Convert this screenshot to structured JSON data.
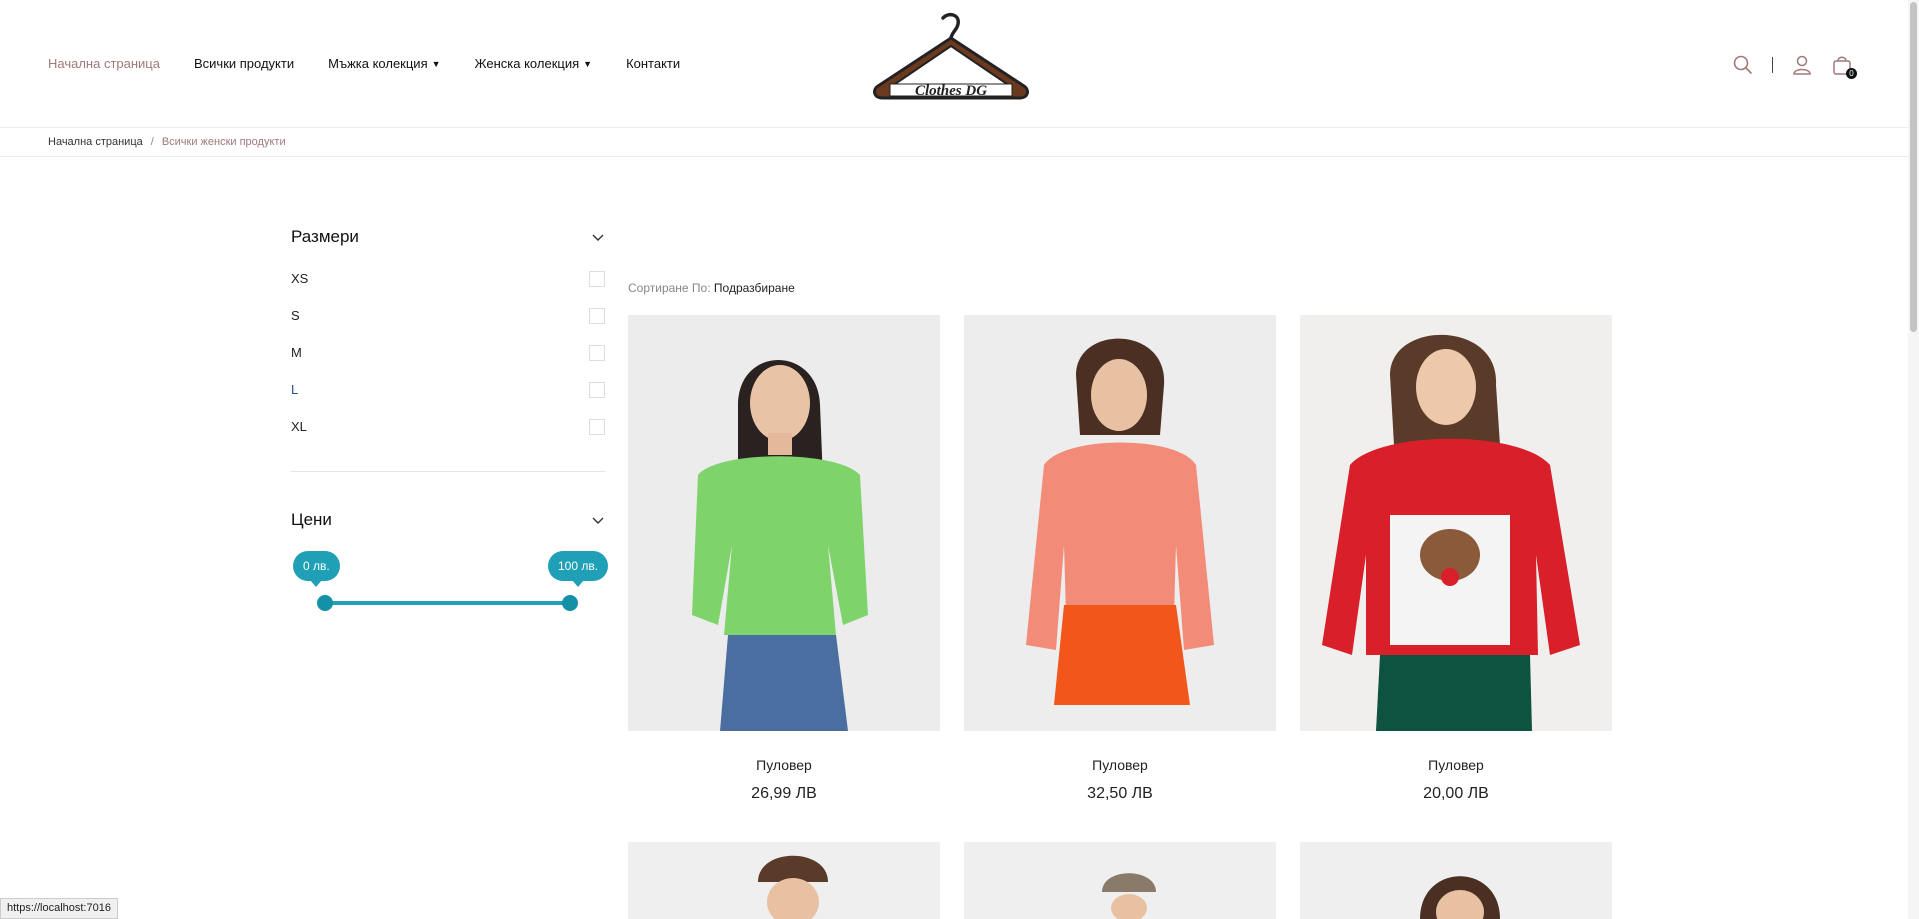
{
  "nav": {
    "home": "Начална страница",
    "all_products": "Всички продукти",
    "men": "Мъжка колекция",
    "women": "Женска колекция",
    "contacts": "Контакти"
  },
  "logo": {
    "text": "Clothes DG"
  },
  "header": {
    "cart_count": "0",
    "icons": [
      "search-icon",
      "user-icon",
      "cart-icon"
    ]
  },
  "breadcrumb": {
    "home": "Начална страница",
    "sep": "/",
    "current": "Всички женски продукти"
  },
  "filters": {
    "sizes_title": "Размери",
    "sizes": [
      "XS",
      "S",
      "M",
      "L",
      "XL"
    ],
    "price_title": "Цени",
    "price_min_label": "0 лв.",
    "price_max_label": "100 лв."
  },
  "sort": {
    "label": "Сортиране  По:",
    "value": "Подразбиране"
  },
  "products": [
    {
      "name": "Пуловер",
      "price": "26,99 ЛВ"
    },
    {
      "name": "Пуловер",
      "price": "32,50 ЛВ"
    },
    {
      "name": "Пуловер",
      "price": "20,00 ЛВ"
    }
  ],
  "status_url": "https://localhost:7016",
  "colors": {
    "accent": "#a0787a",
    "slider": "#1fa0b7"
  }
}
